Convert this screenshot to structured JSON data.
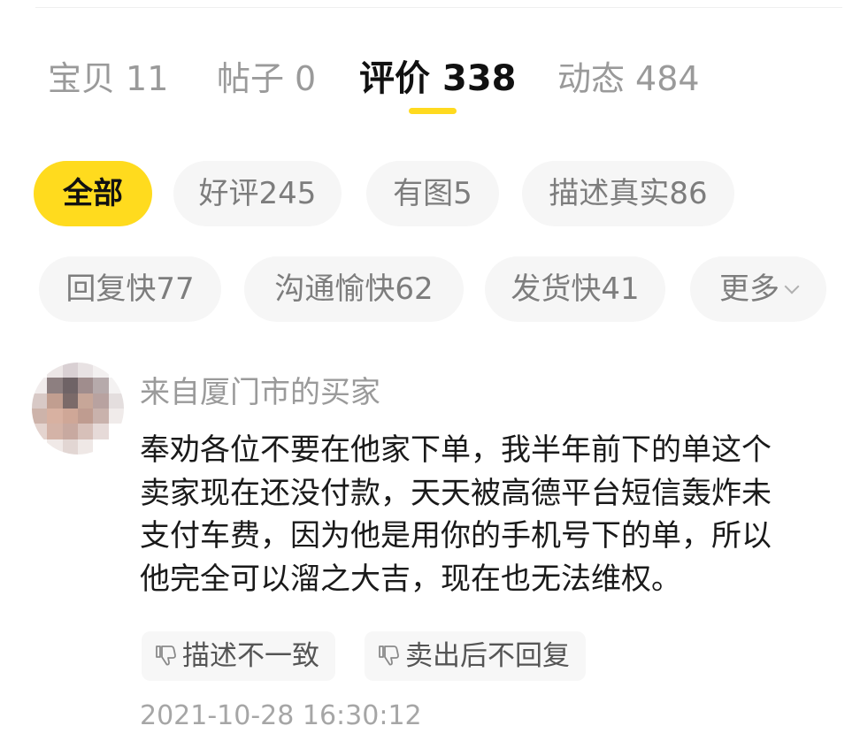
{
  "tabs": [
    {
      "label": "宝贝",
      "count": "11"
    },
    {
      "label": "帖子",
      "count": "0"
    },
    {
      "label": "评价",
      "count": "338"
    },
    {
      "label": "动态",
      "count": "484"
    }
  ],
  "active_tab": "评价",
  "filters": {
    "row1": [
      "全部",
      "好评245",
      "有图5",
      "描述真实86"
    ],
    "row2": [
      "回复快77",
      "沟通愉快62",
      "发货快41",
      "更多"
    ],
    "active": "全部"
  },
  "review": {
    "reviewer": "来自厦门市的买家",
    "lines": [
      "奉劝各位不要在他家下单，我半年前下的单这个",
      "卖家现在还没付款，天天被高德平台短信轰炸未",
      "支付车费，因为他是用你的手机号下的单，所以",
      "他完全可以溜之大吉，现在也无法维权。"
    ],
    "tags": [
      {
        "icon": "thumbs-down-icon",
        "label": "描述不一致"
      },
      {
        "icon": "thumbs-down-icon",
        "label": "卖出后不回复"
      }
    ],
    "timestamp": "2021-10-28 16:30:12"
  },
  "colors": {
    "accent": "#ffdb1e",
    "muted_text": "#9a9a9a",
    "chip_bg": "#f6f6f6"
  }
}
